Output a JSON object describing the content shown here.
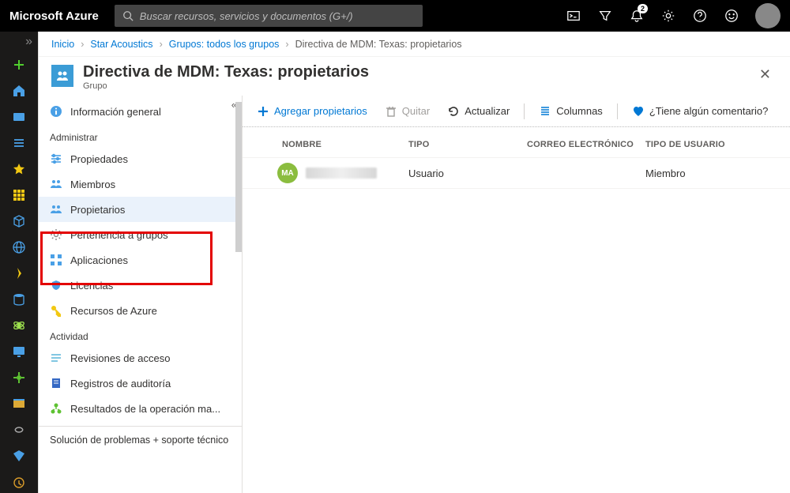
{
  "brand": "Microsoft Azure",
  "search": {
    "placeholder": "Buscar recursos, servicios y documentos (G+/)"
  },
  "notifications": {
    "count": "2"
  },
  "breadcrumb": {
    "items": [
      "Inicio",
      "Star Acoustics",
      "Grupos: todos los grupos"
    ],
    "current": "Directiva de MDM: Texas: propietarios"
  },
  "blade": {
    "title": "Directiva de MDM: Texas: propietarios",
    "subtitle": "Grupo"
  },
  "sidemenu": {
    "overview": "Información general",
    "section_manage": "Administrar",
    "properties": "Propiedades",
    "members": "Miembros",
    "owners": "Propietarios",
    "group_membership": "Pertenencia a grupos",
    "applications": "Aplicaciones",
    "licenses": "Licencias",
    "azure_resources": "Recursos de Azure",
    "section_activity": "Actividad",
    "access_reviews": "Revisiones de acceso",
    "audit_logs": "Registros de auditoría",
    "bulk_results": "Resultados de la operación ma...",
    "troubleshoot": "Solución de problemas + soporte técnico"
  },
  "toolbar": {
    "add": "Agregar propietarios",
    "remove": "Quitar",
    "refresh": "Actualizar",
    "columns": "Columnas",
    "feedback": "¿Tiene algún comentario?"
  },
  "table": {
    "headers": {
      "name": "NOMBRE",
      "type": "TIPO",
      "email": "CORREO ELECTRÓNICO",
      "utype": "TIPO DE USUARIO"
    },
    "rows": [
      {
        "initials": "MA",
        "name": "",
        "type": "Usuario",
        "email": "",
        "utype": "Miembro"
      }
    ]
  },
  "colors": {
    "accent": "#0078d4",
    "heart": "#0078d4"
  }
}
